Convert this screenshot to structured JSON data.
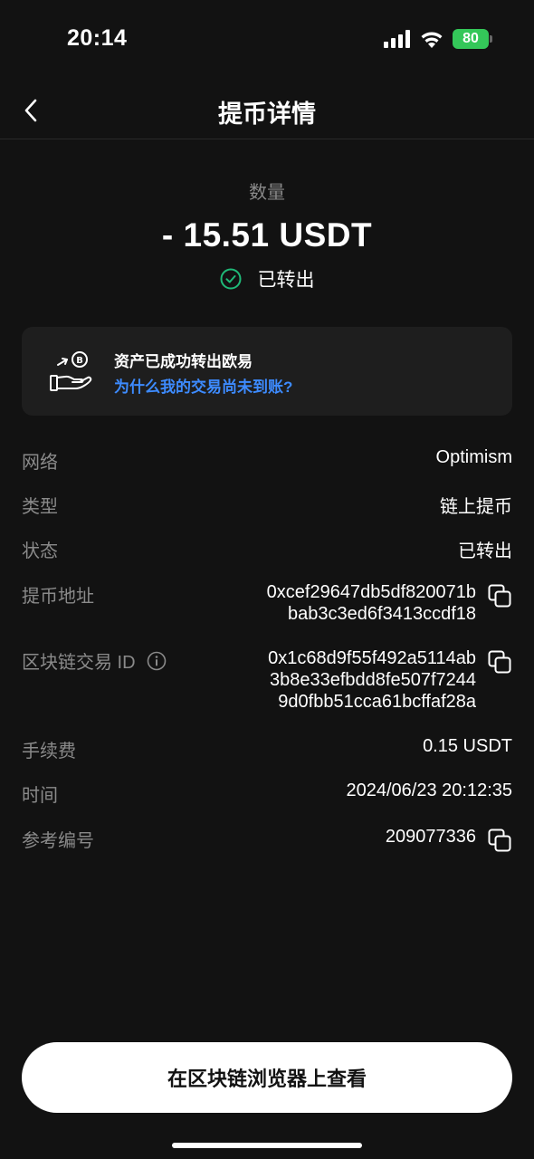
{
  "status_bar": {
    "time": "20:14",
    "battery": "80"
  },
  "nav": {
    "title": "提币详情"
  },
  "amount": {
    "label": "数量",
    "value": "- 15.51 USDT",
    "status": "已转出"
  },
  "card": {
    "title": "资产已成功转出欧易",
    "link": "为什么我的交易尚未到账?"
  },
  "details": {
    "network_label": "网络",
    "network_value": "Optimism",
    "type_label": "类型",
    "type_value": "链上提币",
    "state_label": "状态",
    "state_value": "已转出",
    "address_label": "提币地址",
    "address_line1": "0xcef29647db5df820071b",
    "address_line2": "bab3c3ed6f3413ccdf18",
    "txid_label": "区块链交易 ID",
    "txid_line1": "0x1c68d9f55f492a5114ab",
    "txid_line2": "3b8e33efbdd8fe507f7244",
    "txid_line3": "9d0fbb51cca61bcffaf28a",
    "fee_label": "手续费",
    "fee_value": "0.15 USDT",
    "time_label": "时间",
    "time_value": "2024/06/23 20:12:35",
    "ref_label": "参考编号",
    "ref_value": "209077336"
  },
  "bottom_button": {
    "label": "在区块链浏览器上查看"
  },
  "colors": {
    "background": "#121212",
    "accent_blue": "#3d8bff",
    "success_green": "#1fb978",
    "muted": "#8a8a8a"
  }
}
